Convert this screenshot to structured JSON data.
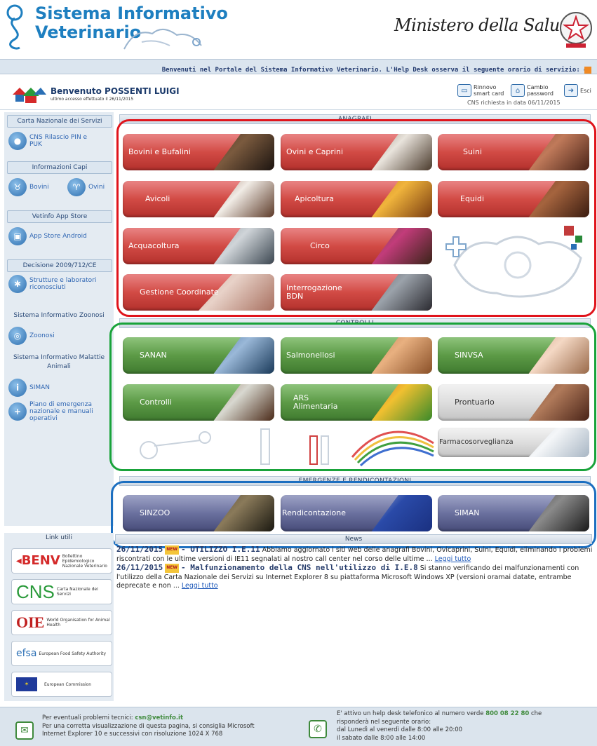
{
  "header": {
    "title_line1": "Sistema Informativo",
    "title_line2": "Veterinario",
    "ministero": "Ministero della Salute",
    "ticker": "Benvenuti nel Portale del Sistema Informativo Veterinario. L'Help Desk osserva il seguente orario di servizio: da"
  },
  "user": {
    "welcome": "Benvenuto POSSENTI LUIGI",
    "last_access": "ultimo accesso effettuato il 26/11/2015",
    "cns_note": "CNS richiesta in data 06/11/2015"
  },
  "toolbar": {
    "rinnovo": "Rinnovo smart card",
    "cambio": "Cambio password",
    "esci": "Esci"
  },
  "sidebar": {
    "cns_head": "Carta Nazionale dei Servizi",
    "cns_item": "CNS Rilascio PIN e PUK",
    "capi_head": "Informazioni Capi",
    "capi_bovini": "Bovini",
    "capi_ovini": "Ovini",
    "app_head": "Vetinfo App Store",
    "app_item": "App Store Android",
    "decisione_head": "Decisione 2009/712/CE",
    "decisione_item": "Strutture e laboratori riconosciuti",
    "zoonosi_head": "Sistema Informativo Zoonosi",
    "zoonosi_item": "Zoonosi",
    "malattie_head": "Sistema Informativo Malattie Animali",
    "siman_item": "SIMAN",
    "piano_item": "Piano di emergenza nazionale e manuali operativi"
  },
  "sections": {
    "anagrafi": "ANAGRAFI",
    "controlli": "CONTROLLI",
    "emergenze": "EMERGENZE E RENDICONTAZIONI",
    "news": "News",
    "link_utili": "Link utili"
  },
  "tiles": {
    "bovini": "Bovini e Bufalini",
    "ovini": "Ovini e Caprini",
    "suini": "Suini",
    "avicoli": "Avicoli",
    "apicoltura": "Apicoltura",
    "equidi": "Equidi",
    "acquacoltura": "Acquacoltura",
    "circo": "Circo",
    "gestione": "Gestione Coordinate",
    "interrogazione": "Interrogazione BDN",
    "sanan": "SANAN",
    "salmonellosi": "Salmonellosi",
    "sinvsa": "SINVSA",
    "controlli": "Controlli",
    "ars": "ARS Alimentaria",
    "prontuario": "Prontuario",
    "farmaco": "Farmacosorveglianza",
    "sinzoo": "SINZOO",
    "rendicontazione": "Rendicontazione",
    "siman": "SIMAN"
  },
  "links": {
    "benv": "BENV",
    "benv_sub": "Bollettino Epidemiologico Nazionale Veterinario",
    "cns": "CNS",
    "cns_sub": "Carta Nazionale dei Servizi",
    "oie": "OIE",
    "oie_sub": "World Organisation for Animal Health",
    "efsa": "efsa",
    "efsa_sub": "European Food Safety Authority",
    "ec_sub": "European Commission"
  },
  "news": [
    {
      "date": "26/11/2015",
      "badge": "NEW",
      "title": "- UTILIZZO I.E.11",
      "body": "Abbiamo aggiornato i siti web delle anagrafi Bovini, Ovicaprini, Suini, Equidi, eliminando i problemi riscontrati con le ultime versioni di IE11 segnalati al nostro call center nel corso delle ultime ...",
      "link": "Leggi tutto"
    },
    {
      "date": "26/11/2015",
      "badge": "NEW",
      "title": "- Malfunzionamento della CNS nell'utilizzo di I.E.8",
      "body": "Si stanno verificando dei malfunzionamenti con l'utilizzo della Carta Nazionale dei Servizi su Internet Explorer 8 su piattaforma Microsoft Windows XP (versioni oramai datate, entrambe deprecate e non ...",
      "link": "Leggi tutto"
    }
  ],
  "footer": {
    "left_line1_pre": "Per eventuali problemi tecnici: ",
    "email": "csn@vetinfo.it",
    "left_line2": "Per una corretta visualizzazione di questa pagina, si consiglia Microsoft",
    "left_line3": "Internet Explorer 10 e successivi con risoluzione 1024 X 768",
    "right_line1_pre": "E' attivo un help desk telefonico al numero verde ",
    "phone": "800 08 22 80",
    "right_line1_post": " che",
    "right_line2": "risponderà nel seguente orario:",
    "right_line3": "dal Lunedì al venerdì dalle 8:00 alle 20:00",
    "right_line4": "il sabato dalle 8:00 alle 14:00"
  },
  "colors": {
    "anagrafi_outline": "#e0141c",
    "controlli_outline": "#19a33a",
    "emergenze_outline": "#1c6fc0"
  }
}
